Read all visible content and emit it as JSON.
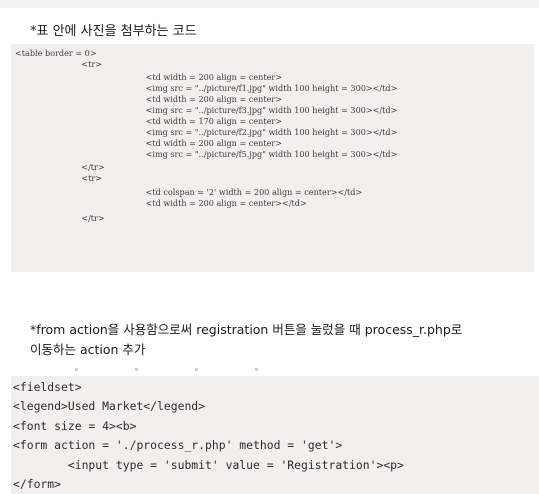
{
  "section1": {
    "heading": "*표 안에 사진을 첨부하는 코드",
    "code_lines": [
      "<table border = 0>",
      "    <tr>",
      "        <td width = 200 align = center>",
      "        <img src = \"../picture/f1.jpg\" width 100 height = 300></td>",
      "        <td width = 200 align = center>",
      "        <img src = \"../picture/f3.jpg\" width 100 height = 300></td>",
      "        <td width = 170 align = center>",
      "        <img src = \"../picture/f2.jpg\" width 100 height = 300></td>",
      "        <td width = 200 align = center>",
      "        <img src = \"../picture/f5.jpg\" width 100 height = 300></td>",
      "    </tr>",
      "    <tr>",
      "        <td colspan = '2' width = 200 align = center></td>",
      "        <td width = 200 align = center></td>",
      "    </tr>"
    ]
  },
  "section2": {
    "paragraph_line1": "*from action을 사용함으로써 registration 버튼을 눌렀을 때 process_r.php로",
    "paragraph_line2": "이동하는 action 추가",
    "code_lines": [
      "<fieldset>",
      "<legend>Used Market</legend>",
      "<font size = 4><b>",
      "<form action = './process_r.php' method = 'get'>",
      "        <input type = 'submit' value = 'Registration'><p>",
      "</form>"
    ]
  }
}
